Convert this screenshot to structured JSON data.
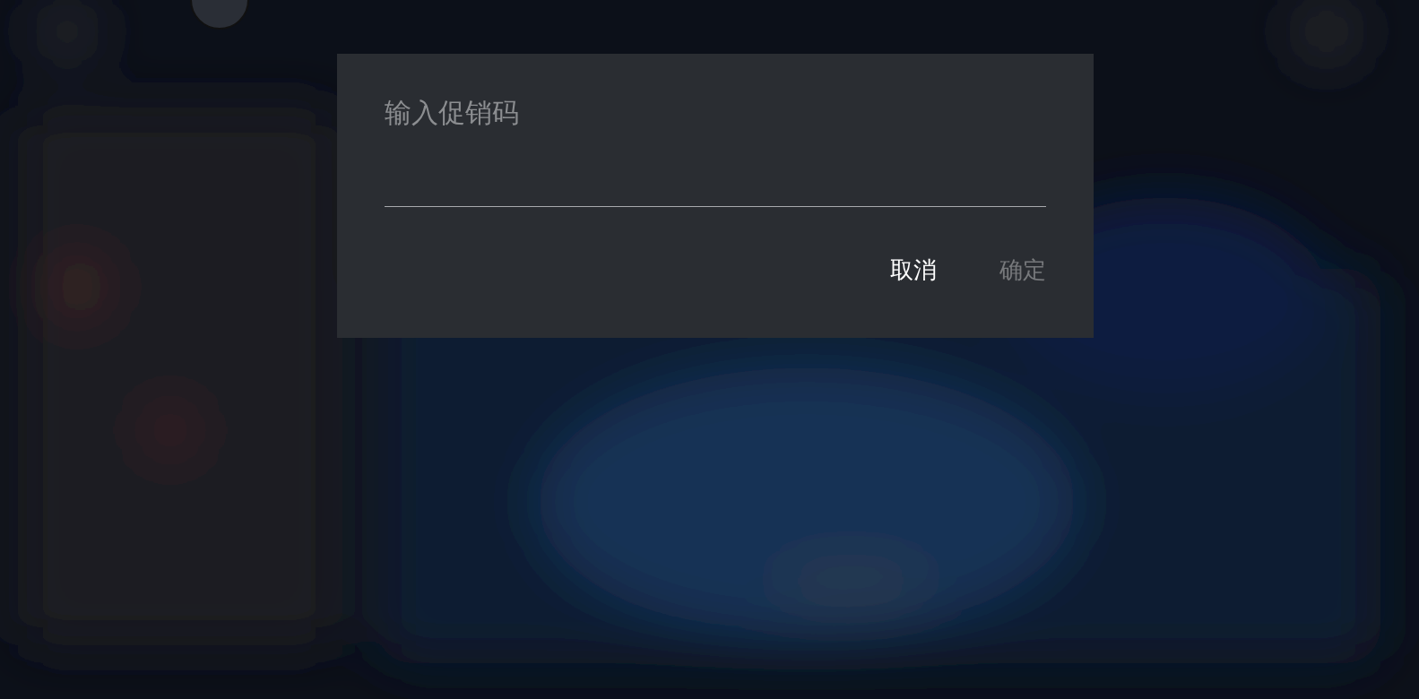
{
  "dialog": {
    "title": "输入促销码",
    "buttons": [
      {
        "label": "取消",
        "disabled": false
      },
      {
        "label": "确定",
        "disabled": true
      }
    ]
  }
}
